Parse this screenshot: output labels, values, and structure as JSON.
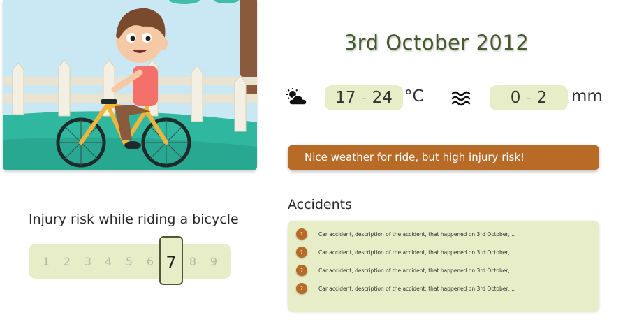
{
  "date": "3rd October 2012",
  "weather": {
    "icon": "partly-cloudy-icon",
    "temp_min": "17",
    "temp_max": "24",
    "temp_sep": "-",
    "temp_unit": "°C",
    "rain_icon": "wave-icon",
    "rain_min": "0",
    "rain_max": "2",
    "rain_sep": "-",
    "rain_unit": "mm"
  },
  "banner": {
    "text": "Nice weather for ride, but high injury risk!",
    "color": "#b86b26"
  },
  "injury_risk": {
    "title": "Injury risk while riding a bicycle",
    "scale": [
      "1",
      "2",
      "3",
      "4",
      "5",
      "6",
      "7",
      "8",
      "9"
    ],
    "selected": "7"
  },
  "accidents": {
    "title": "Accidents",
    "items": [
      {
        "badge": "?",
        "text": "Car accident, description of the accident, that happened on 3rd October, .."
      },
      {
        "badge": "?",
        "text": "Car accident, description of the accident, that happened on 3rd October, .."
      },
      {
        "badge": "?",
        "text": "Car accident, description of the accident, that happened on 3rd October, .."
      },
      {
        "badge": "?",
        "text": "Car accident, description of the accident, that happened on 3rd October, .."
      }
    ]
  },
  "colors": {
    "panel": "#e7edc6",
    "accent": "#b86b26",
    "date": "#455a2c"
  }
}
